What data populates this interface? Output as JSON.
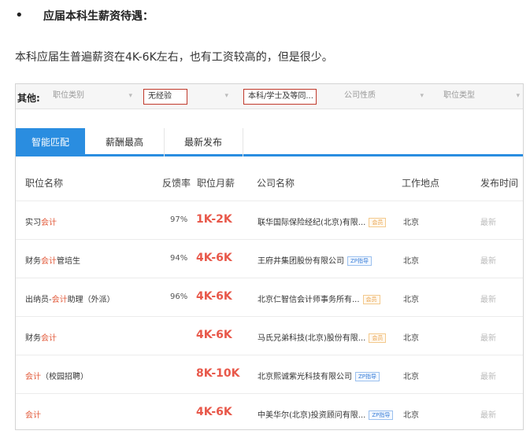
{
  "article": {
    "bullet": "•",
    "heading": "应届本科生薪资待遇：",
    "paragraph": "本科应届生普遍薪资在4K-6K左右，也有工资较高的，但是很少。"
  },
  "filters": {
    "label": "其他:",
    "dropdowns": [
      {
        "label": "职位类别",
        "active": false
      },
      {
        "label": "无经验",
        "active": true
      },
      {
        "label": "本科/学士及等同...",
        "active": true
      },
      {
        "label": "公司性质",
        "active": false
      },
      {
        "label": "职位类型",
        "active": false
      }
    ],
    "caret": "▾"
  },
  "tabs": [
    {
      "label": "智能匹配",
      "active": true
    },
    {
      "label": "薪酬最高",
      "active": false
    },
    {
      "label": "最新发布",
      "active": false
    }
  ],
  "columns": {
    "job": "职位名称",
    "rate": "反馈率",
    "salary": "职位月薪",
    "company": "公司名称",
    "city": "工作地点",
    "date": "发布时间"
  },
  "rows": [
    {
      "job_pre": "实习",
      "job_acc": "会计",
      "job_post": "",
      "rate": "97%",
      "salary": "1K-2K",
      "company": "联华国际保险经纪(北京)有限...",
      "badge": "会员",
      "badge_type": "member",
      "city": "北京",
      "date": "最新"
    },
    {
      "job_pre": "财务",
      "job_acc": "会计",
      "job_post": "管培生",
      "rate": "94%",
      "salary": "4K-6K",
      "company": "王府井集团股份有限公司",
      "badge": "ZP指导",
      "badge_type": "zp",
      "city": "北京",
      "date": "最新"
    },
    {
      "job_pre": "出纳员-",
      "job_acc": "会计",
      "job_post": "助理（外派）",
      "rate": "96%",
      "salary": "4K-6K",
      "company": "北京仁智信会计师事务所有...",
      "badge": "会员",
      "badge_type": "member",
      "city": "北京",
      "date": "最新"
    },
    {
      "job_pre": "财务",
      "job_acc": "会计",
      "job_post": "",
      "rate": "",
      "salary": "4K-6K",
      "company": "马氏兄弟科技(北京)股份有限...",
      "badge": "会员",
      "badge_type": "member",
      "city": "北京",
      "date": "最新"
    },
    {
      "job_pre": "",
      "job_acc": "会计",
      "job_post": "（校园招聘）",
      "rate": "",
      "salary": "8K-10K",
      "company": "北京熙诚紫光科技有限公司",
      "badge": "ZP指导",
      "badge_type": "zp",
      "city": "北京",
      "date": "最新"
    },
    {
      "job_pre": "",
      "job_acc": "会计",
      "job_post": "",
      "rate": "",
      "salary": "4K-6K",
      "company": "中美华尔(北京)投资顾问有限...",
      "badge": "ZP指导",
      "badge_type": "zp",
      "city": "北京",
      "date": "最新"
    }
  ]
}
